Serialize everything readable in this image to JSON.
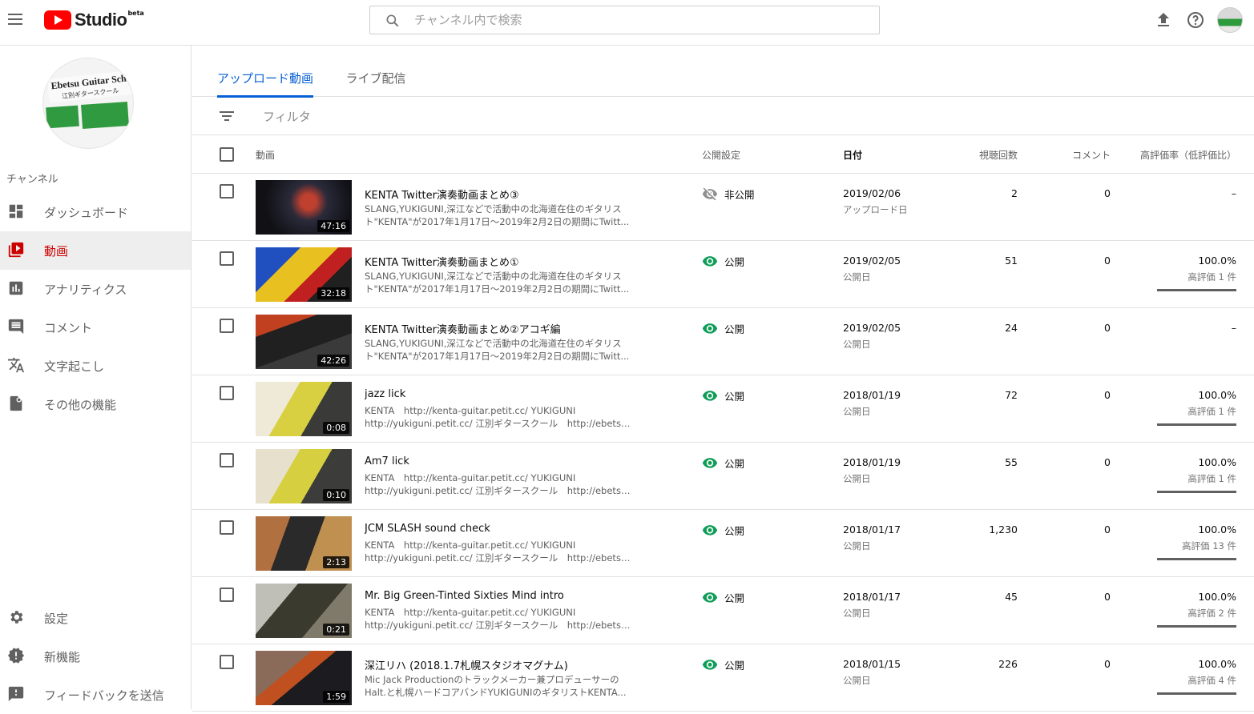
{
  "app": {
    "logo_text": "Studio",
    "logo_badge": "beta",
    "search_placeholder": "チャンネル内で検索"
  },
  "channel": {
    "sign_line1": "Ebetsu Guitar School",
    "sign_line2": "江別ギタースクール",
    "label": "チャンネル"
  },
  "sidebar": {
    "items": [
      {
        "label": "ダッシュボード",
        "icon": "dashboard-icon"
      },
      {
        "label": "動画",
        "icon": "video-library-icon",
        "active": true
      },
      {
        "label": "アナリティクス",
        "icon": "analytics-icon"
      },
      {
        "label": "コメント",
        "icon": "comment-icon"
      },
      {
        "label": "文字起こし",
        "icon": "translate-icon"
      },
      {
        "label": "その他の機能",
        "icon": "other-features-icon"
      }
    ],
    "bottom_items": [
      {
        "label": "設定",
        "icon": "gear-icon"
      },
      {
        "label": "新機能",
        "icon": "whats-new-icon"
      },
      {
        "label": "フィードバックを送信",
        "icon": "feedback-icon"
      }
    ]
  },
  "tabs": [
    "アップロード動画",
    "ライブ配信"
  ],
  "filter_label": "フィルタ",
  "columns": {
    "video": "動画",
    "visibility": "公開設定",
    "date": "日付",
    "views": "視聴回数",
    "comments": "コメント",
    "rating": "高評価率（低評価比）"
  },
  "colors": {
    "accent_blue": "#065fd4",
    "active_red": "#cc0000",
    "public_green": "#0f9d58",
    "youtube_red": "#ff0000"
  },
  "videos": [
    {
      "title": "KENTA Twitter演奏動画まとめ③",
      "desc1": "SLANG,YUKIGUNI,深江などで活動中の北海道在住のギタリス",
      "desc2": "ト\"KENTA\"が2017年1月17日〜2019年2月2日の期間にTwitt...",
      "duration": "47:16",
      "visibility": "非公開",
      "public": false,
      "date": "2019/02/06",
      "date_label": "アップロード日",
      "views": "2",
      "comments": "0",
      "rating": "–",
      "rating_sub": "",
      "rating_fraction": null
    },
    {
      "title": "KENTA Twitter演奏動画まとめ①",
      "desc1": "SLANG,YUKIGUNI,深江などで活動中の北海道在住のギタリス",
      "desc2": "ト\"KENTA\"が2017年1月17日〜2019年2月2日の期間にTwitt...",
      "duration": "32:18",
      "visibility": "公開",
      "public": true,
      "date": "2019/02/05",
      "date_label": "公開日",
      "views": "51",
      "comments": "0",
      "rating": "100.0%",
      "rating_sub": "高評価 1 件",
      "rating_fraction": 1.0
    },
    {
      "title": "KENTA Twitter演奏動画まとめ②アコギ編",
      "desc1": "SLANG,YUKIGUNI,深江などで活動中の北海道在住のギタリス",
      "desc2": "ト\"KENTA\"が2017年1月17日〜2019年2月2日の期間にTwitt...",
      "duration": "42:26",
      "visibility": "公開",
      "public": true,
      "date": "2019/02/05",
      "date_label": "公開日",
      "views": "24",
      "comments": "0",
      "rating": "–",
      "rating_sub": "",
      "rating_fraction": null
    },
    {
      "title": "jazz lick",
      "desc1": "KENTA　http://kenta-guitar.petit.cc/ YUKIGUNI",
      "desc2": "http://yukiguni.petit.cc/ 江別ギタースクール　http://ebetsu...",
      "duration": "0:08",
      "visibility": "公開",
      "public": true,
      "date": "2018/01/19",
      "date_label": "公開日",
      "views": "72",
      "comments": "0",
      "rating": "100.0%",
      "rating_sub": "高評価 1 件",
      "rating_fraction": 1.0
    },
    {
      "title": "Am7 lick",
      "desc1": "KENTA　http://kenta-guitar.petit.cc/ YUKIGUNI",
      "desc2": "http://yukiguni.petit.cc/ 江別ギタースクール　http://ebetsu...",
      "duration": "0:10",
      "visibility": "公開",
      "public": true,
      "date": "2018/01/19",
      "date_label": "公開日",
      "views": "55",
      "comments": "0",
      "rating": "100.0%",
      "rating_sub": "高評価 1 件",
      "rating_fraction": 1.0
    },
    {
      "title": "JCM SLASH sound check",
      "desc1": "KENTA　http://kenta-guitar.petit.cc/ YUKIGUNI",
      "desc2": "http://yukiguni.petit.cc/ 江別ギタースクール　http://ebetsu...",
      "duration": "2:13",
      "visibility": "公開",
      "public": true,
      "date": "2018/01/17",
      "date_label": "公開日",
      "views": "1,230",
      "comments": "0",
      "rating": "100.0%",
      "rating_sub": "高評価 13 件",
      "rating_fraction": 1.0
    },
    {
      "title": "Mr. Big Green-Tinted Sixties Mind intro",
      "desc1": "KENTA　http://kenta-guitar.petit.cc/ YUKIGUNI",
      "desc2": "http://yukiguni.petit.cc/ 江別ギタースクール　http://ebetsu...",
      "duration": "0:21",
      "visibility": "公開",
      "public": true,
      "date": "2018/01/17",
      "date_label": "公開日",
      "views": "45",
      "comments": "0",
      "rating": "100.0%",
      "rating_sub": "高評価 2 件",
      "rating_fraction": 1.0
    },
    {
      "title": "深江リハ (2018.1.7札幌スタジオマグナム)",
      "desc1": "Mic Jack Productionのトラックメーカー兼プロデューサーの",
      "desc2": "Halt.と札幌ハードコアバンドYUKIGUNIのギタリストKENTA...",
      "duration": "1:59",
      "visibility": "公開",
      "public": true,
      "date": "2018/01/15",
      "date_label": "公開日",
      "views": "226",
      "comments": "0",
      "rating": "100.0%",
      "rating_sub": "高評価 4 件",
      "rating_fraction": 1.0
    }
  ]
}
